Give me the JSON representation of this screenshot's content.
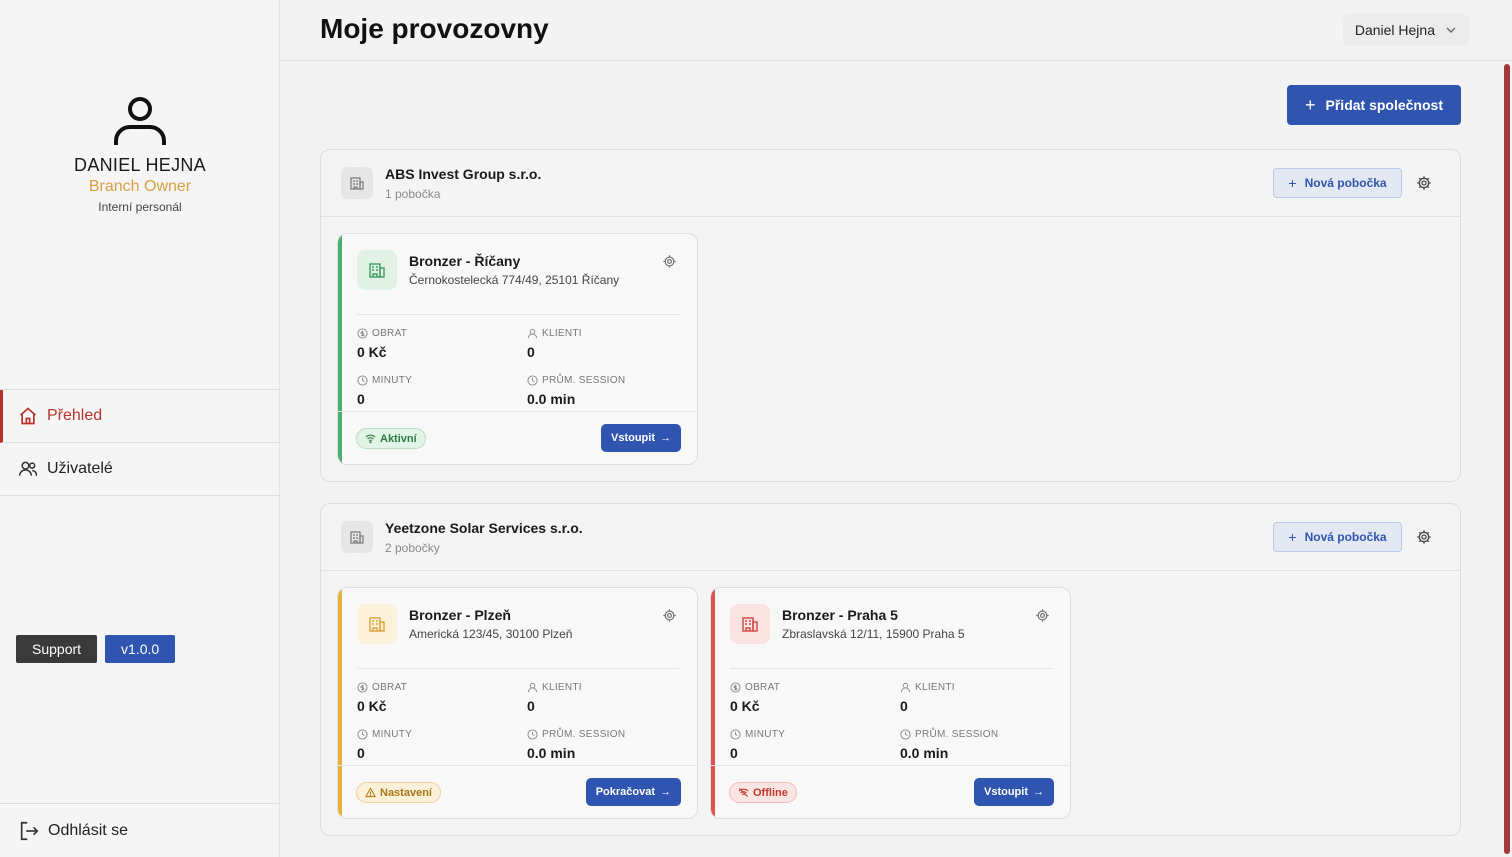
{
  "profile": {
    "name": "DANIEL HEJNA",
    "role": "Branch Owner",
    "subtitle": "Interní personál"
  },
  "nav": {
    "overview": "Přehled",
    "users": "Uživatelé"
  },
  "support": {
    "support_label": "Support",
    "version_label": "v1.0.0"
  },
  "logout_label": "Odhlásit se",
  "header": {
    "title": "Moje provozovny",
    "user_name": "Daniel Hejna"
  },
  "add_company_label": "Přidat společnost",
  "new_branch_label": "Nová pobočka",
  "stat_labels": {
    "revenue": "OBRAT",
    "clients": "KLIENTI",
    "minutes": "MINUTY",
    "avg_session": "PRŮM. SESSION"
  },
  "colors": {
    "accent": "#2f55b0",
    "active_nav": "#b8322c",
    "green": "#4caf72",
    "yellow": "#e6b33a",
    "red": "#d9534f"
  },
  "companies": [
    {
      "name": "ABS Invest Group s.r.o.",
      "count": "1 pobočka",
      "branches": [
        {
          "name": "Bronzer - Říčany",
          "address": "Černokostelecká 774/49, 25101 Říčany",
          "revenue": "0 Kč",
          "clients": "0",
          "minutes": "0",
          "avg_session": "0.0 min",
          "status": "Aktivní",
          "action": "Vstoupit"
        }
      ]
    },
    {
      "name": "Yeetzone Solar Services s.r.o.",
      "count": "2 pobočky",
      "branches": [
        {
          "name": "Bronzer - Plzeň",
          "address": "Americká 123/45, 30100 Plzeň",
          "revenue": "0 Kč",
          "clients": "0",
          "minutes": "0",
          "avg_session": "0.0 min",
          "status": "Nastavení",
          "action": "Pokračovat"
        },
        {
          "name": "Bronzer - Praha 5",
          "address": "Zbraslavská 12/11, 15900 Praha 5",
          "revenue": "0 Kč",
          "clients": "0",
          "minutes": "0",
          "avg_session": "0.0 min",
          "status": "Offline",
          "action": "Vstoupit"
        }
      ]
    }
  ]
}
